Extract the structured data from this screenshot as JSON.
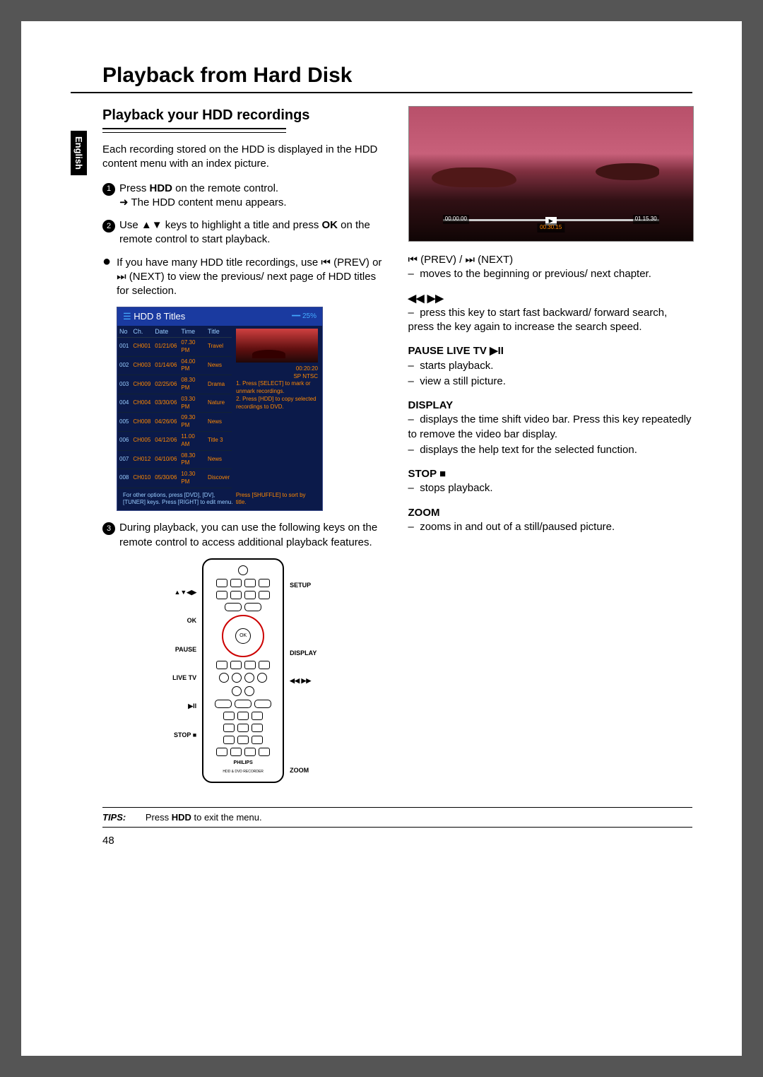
{
  "lang_tab": "English",
  "title": "Playback from Hard Disk",
  "section_title": "Playback your HDD recordings",
  "intro": "Each recording stored on the HDD is displayed in the HDD content menu with an index picture.",
  "step1_a": "Press ",
  "step1_b": "HDD",
  "step1_c": " on the remote control.",
  "step1_sub": "The HDD content menu appears.",
  "step2_a": "Use ▲▼ keys to highlight a title and press ",
  "step2_b": "OK",
  "step2_c": " on the remote control to start playback.",
  "bullet_a": "If you have many HDD title recordings, use  ",
  "prev_icon": "⏮",
  "prev_lbl": "(PREV)",
  "bullet_b": " or  ",
  "next_icon": "⏭",
  "next_lbl": "(NEXT)",
  "bullet_c": " to view the previous/ next page of HDD titles for selection.",
  "hdd": {
    "title": "HDD 8 Titles",
    "percent": "25%",
    "cols": [
      "No",
      "Ch.",
      "Date",
      "Time",
      "Title"
    ],
    "rows": [
      [
        "001",
        "CH001",
        "01/21/06",
        "07.30 PM",
        "Travel"
      ],
      [
        "002",
        "CH003",
        "01/14/06",
        "04.00 PM",
        "News"
      ],
      [
        "003",
        "CH009",
        "02/25/06",
        "08.30 PM",
        "Drama"
      ],
      [
        "004",
        "CH004",
        "03/30/06",
        "03.30 PM",
        "Nature"
      ],
      [
        "005",
        "CH008",
        "04/26/06",
        "09.30 PM",
        "News"
      ],
      [
        "006",
        "CH005",
        "04/12/06",
        "11.00 AM",
        "Title 3"
      ],
      [
        "007",
        "CH012",
        "04/10/06",
        "08.30 PM",
        "News"
      ],
      [
        "008",
        "CH010",
        "05/30/06",
        "10.30 PM",
        "Discover"
      ]
    ],
    "preview_meta": "00:20:20\nSP NTSC",
    "hint1": "1. Press [SELECT] to mark or unmark recordings.",
    "hint2": "2. Press [HDD] to copy selected recordings to DVD.",
    "footer_left": "For other options, press [DVD], [DV], [TUNER] keys. Press [RIGHT] to edit menu.",
    "footer_right": "Press [SHUFFLE] to sort by title."
  },
  "step3": "During playback, you can use the following keys on the remote control to access additional playback features.",
  "remote_labels": {
    "nav": "▲▼◀▶",
    "ok": "OK",
    "pause1": "PAUSE",
    "pause2": "LIVE TV",
    "pause3": "▶II",
    "stop": "STOP ■",
    "setup": "SETUP",
    "display": "DISPLAY",
    "scan": "◀◀ ▶▶",
    "zoom": "ZOOM",
    "brand": "PHILIPS",
    "brand_sub": "HDD & DVD RECORDER"
  },
  "tv": {
    "t_left": "00.00.00",
    "t_right": "01.15.30",
    "mini": "00.30.15"
  },
  "prevnext_line_a": "⏮ (PREV) / ⏭ (NEXT)",
  "prevnext_body": "moves to the beginning or previous/ next chapter.",
  "scan_header": "◀◀ ▶▶",
  "scan_body": "press this key to start fast backward/ forward search, press the key again to increase the search speed.",
  "pause_header": "PAUSE LIVE TV ▶II",
  "pause_l1": "starts playback.",
  "pause_l2": "view a still picture.",
  "display_header": "DISPLAY",
  "display_l1": "displays the time shift video bar. Press this key repeatedly to remove the video bar display.",
  "display_l2": "displays the help text for the selected function.",
  "stop_header": "STOP ■",
  "stop_l1": "stops playback.",
  "zoom_header": "ZOOM",
  "zoom_l1": "zooms in and out of a still/paused picture.",
  "tips_label": "TIPS:",
  "tips_a": "Press ",
  "tips_b": "HDD",
  "tips_c": " to exit the menu.",
  "page_number": "48"
}
